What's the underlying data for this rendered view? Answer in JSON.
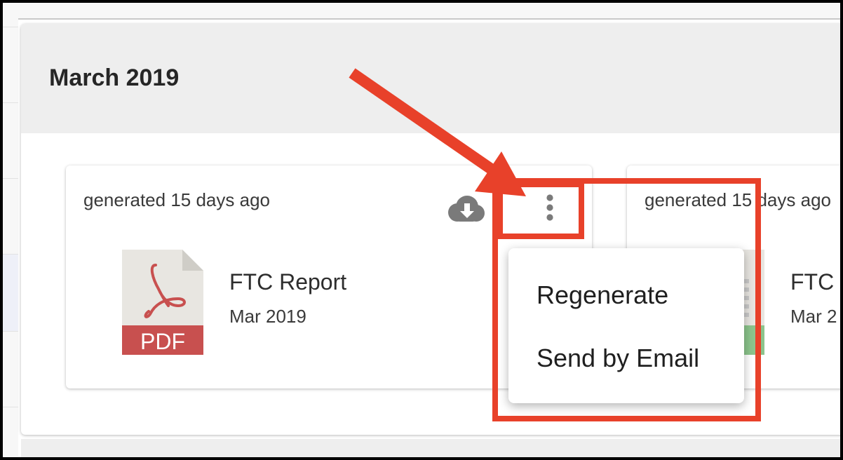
{
  "section": {
    "title": "March 2019"
  },
  "cards": [
    {
      "generated": "generated 15 days ago",
      "doc_title": "FTC Report",
      "doc_date": "Mar 2019",
      "file_type": "PDF",
      "icons": [
        "pdf-file-icon",
        "cloud-download-icon",
        "more-vertical-icon"
      ]
    },
    {
      "generated": "generated 15 days ago",
      "doc_title": "FTC",
      "doc_date": "Mar 2",
      "icons": [
        "spreadsheet-file-icon"
      ]
    }
  ],
  "menu": {
    "items": [
      {
        "label": "Regenerate"
      },
      {
        "label": "Send by Email"
      }
    ]
  },
  "colors": {
    "annotation_red": "#e8412a",
    "pdf_red": "#c8504f",
    "header_bg": "#eeeeee",
    "icon_gray": "#7a7a7a",
    "sheet_green": "#8cc48c"
  }
}
